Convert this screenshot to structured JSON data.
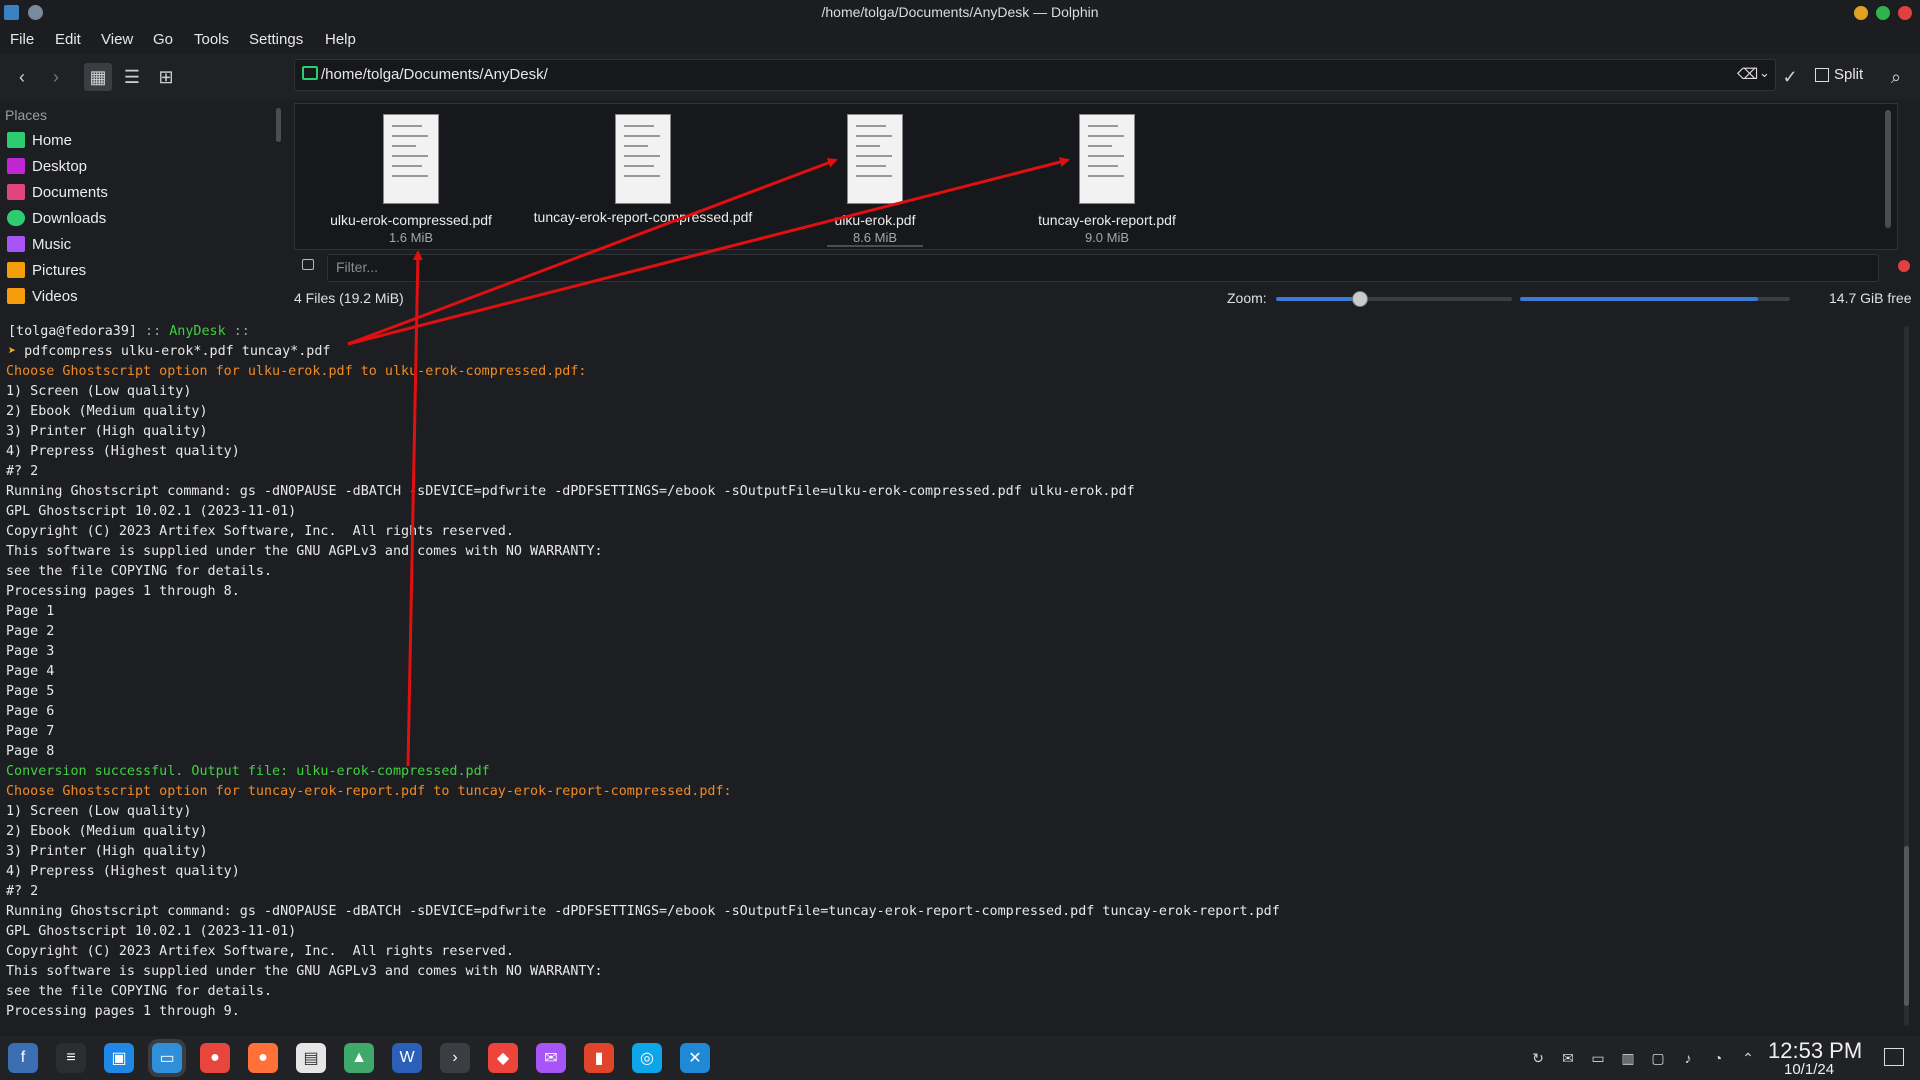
{
  "window": {
    "title": "/home/tolga/Documents/AnyDesk — Dolphin"
  },
  "menu": [
    "File",
    "Edit",
    "View",
    "Go",
    "Tools",
    "Settings",
    "Help"
  ],
  "toolbar": {
    "path": "/home/tolga/Documents/AnyDesk/",
    "split_label": "Split"
  },
  "sidebar": {
    "title": "Places",
    "items": [
      {
        "label": "Home",
        "icon": "home-icon",
        "color": "#2ecc71"
      },
      {
        "label": "Desktop",
        "icon": "desktop-icon",
        "color": "#c026d3"
      },
      {
        "label": "Documents",
        "icon": "documents-icon",
        "color": "#e0457b"
      },
      {
        "label": "Downloads",
        "icon": "downloads-icon",
        "color": "#2ecc71"
      },
      {
        "label": "Music",
        "icon": "music-icon",
        "color": "#a855f7"
      },
      {
        "label": "Pictures",
        "icon": "pictures-icon",
        "color": "#f59e0b"
      },
      {
        "label": "Videos",
        "icon": "videos-icon",
        "color": "#f59e0b"
      }
    ]
  },
  "files": [
    {
      "name": "ulku-erok-compressed.pdf",
      "size": "1.6 MiB"
    },
    {
      "name": "tuncay-erok-report-compressed.pdf",
      "size": ""
    },
    {
      "name": "ulku-erok.pdf",
      "size": "8.6 MiB"
    },
    {
      "name": "tuncay-erok-report.pdf",
      "size": "9.0 MiB"
    }
  ],
  "filter": {
    "placeholder": "Filter..."
  },
  "status": {
    "files": "4 Files (19.2 MiB)",
    "zoom_label": "Zoom:",
    "zoom_level": 0.35,
    "disk_used": 0.88,
    "disk_free": "14.7 GiB free"
  },
  "colors": {
    "accent": "#3b7ad6",
    "orange": "#f08a24",
    "green": "#3fd13f",
    "arrow": "#e01010",
    "prompt_user": "#4cc3f0",
    "prompt_dir": "#3fd13f"
  },
  "terminal": {
    "prompt_user": "[tolga@fedora39]",
    "prompt_sep1": " :: ",
    "prompt_dir": "AnyDesk",
    "prompt_sep2": " ::",
    "prompt_arrow": "➤",
    "command": " pdfcompress ulku-erok*.pdf tuncay*.pdf",
    "lines": [
      {
        "text": "Choose Ghostscript option for ulku-erok.pdf to ulku-erok-compressed.pdf:",
        "color": "orange"
      },
      {
        "text": "1) Screen (Low quality)",
        "color": "white"
      },
      {
        "text": "2) Ebook (Medium quality)",
        "color": "white"
      },
      {
        "text": "3) Printer (High quality)",
        "color": "white"
      },
      {
        "text": "4) Prepress (Highest quality)",
        "color": "white"
      },
      {
        "text": "#? 2",
        "color": "white"
      },
      {
        "text": "Running Ghostscript command: gs -dNOPAUSE -dBATCH -sDEVICE=pdfwrite -dPDFSETTINGS=/ebook -sOutputFile=ulku-erok-compressed.pdf ulku-erok.pdf",
        "color": "white"
      },
      {
        "text": "GPL Ghostscript 10.02.1 (2023-11-01)",
        "color": "white"
      },
      {
        "text": "Copyright (C) 2023 Artifex Software, Inc.  All rights reserved.",
        "color": "white"
      },
      {
        "text": "This software is supplied under the GNU AGPLv3 and comes with NO WARRANTY:",
        "color": "white"
      },
      {
        "text": "see the file COPYING for details.",
        "color": "white"
      },
      {
        "text": "Processing pages 1 through 8.",
        "color": "white"
      },
      {
        "text": "Page 1",
        "color": "white"
      },
      {
        "text": "Page 2",
        "color": "white"
      },
      {
        "text": "Page 3",
        "color": "white"
      },
      {
        "text": "Page 4",
        "color": "white"
      },
      {
        "text": "Page 5",
        "color": "white"
      },
      {
        "text": "Page 6",
        "color": "white"
      },
      {
        "text": "Page 7",
        "color": "white"
      },
      {
        "text": "Page 8",
        "color": "white"
      },
      {
        "text": "Conversion successful. Output file: ulku-erok-compressed.pdf",
        "color": "green"
      },
      {
        "text": "Choose Ghostscript option for tuncay-erok-report.pdf to tuncay-erok-report-compressed.pdf:",
        "color": "orange"
      },
      {
        "text": "1) Screen (Low quality)",
        "color": "white"
      },
      {
        "text": "2) Ebook (Medium quality)",
        "color": "white"
      },
      {
        "text": "3) Printer (High quality)",
        "color": "white"
      },
      {
        "text": "4) Prepress (Highest quality)",
        "color": "white"
      },
      {
        "text": "#? 2",
        "color": "white"
      },
      {
        "text": "Running Ghostscript command: gs -dNOPAUSE -dBATCH -sDEVICE=pdfwrite -dPDFSETTINGS=/ebook -sOutputFile=tuncay-erok-report-compressed.pdf tuncay-erok-report.pdf",
        "color": "white"
      },
      {
        "text": "GPL Ghostscript 10.02.1 (2023-11-01)",
        "color": "white"
      },
      {
        "text": "Copyright (C) 2023 Artifex Software, Inc.  All rights reserved.",
        "color": "white"
      },
      {
        "text": "This software is supplied under the GNU AGPLv3 and comes with NO WARRANTY:",
        "color": "white"
      },
      {
        "text": "see the file COPYING for details.",
        "color": "white"
      },
      {
        "text": "Processing pages 1 through 9.",
        "color": "white"
      }
    ]
  },
  "taskbar": {
    "apps": [
      {
        "name": "fedora-icon",
        "color": "#3c6eb4"
      },
      {
        "name": "menu-icon",
        "color": "#2b2d31"
      },
      {
        "name": "software-store-icon",
        "color": "#1e88e5"
      },
      {
        "name": "dolphin-icon",
        "color": "#2f8fd8"
      },
      {
        "name": "chrome-icon",
        "color": "#e8453c"
      },
      {
        "name": "firefox-icon",
        "color": "#ff7139"
      },
      {
        "name": "text-editor-icon",
        "color": "#e6e6e6"
      },
      {
        "name": "image-viewer-icon",
        "color": "#3fa86b"
      },
      {
        "name": "word-processor-icon",
        "color": "#2b5fb8"
      },
      {
        "name": "terminal-icon",
        "color": "#3a3d42"
      },
      {
        "name": "anydesk-icon",
        "color": "#ef443b"
      },
      {
        "name": "messenger-icon",
        "color": "#a855f7"
      },
      {
        "name": "screen-recorder-icon",
        "color": "#e0452b"
      },
      {
        "name": "network-tool-icon",
        "color": "#0ea5e9"
      },
      {
        "name": "vscode-icon",
        "color": "#1e8ad6"
      }
    ],
    "tray": [
      "sync-icon",
      "messenger-tray-icon",
      "drive-icon",
      "clipboard-icon",
      "devices-icon",
      "volume-icon",
      "wifi-icon",
      "expand-tray-icon"
    ],
    "time": "12:53 PM",
    "date": "10/1/24"
  }
}
